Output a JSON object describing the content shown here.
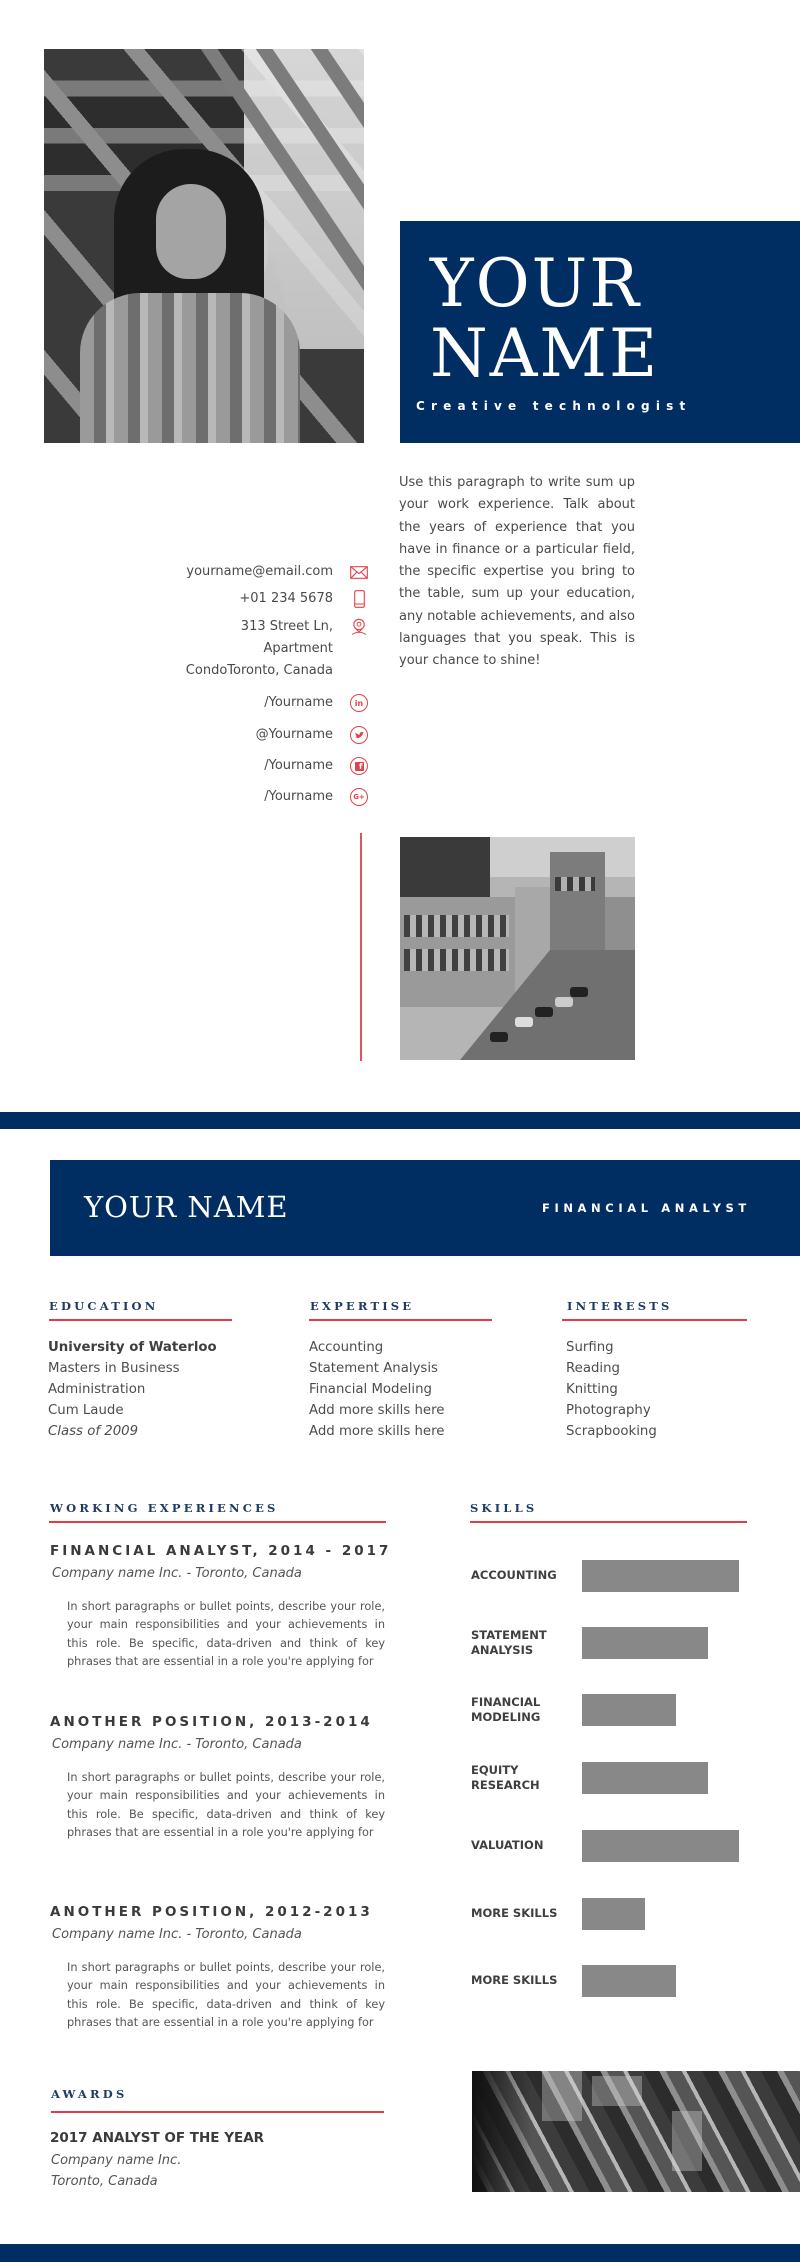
{
  "colors": {
    "navy": "#002e62",
    "accent_red": "#e03c44",
    "bar_gray": "#888888"
  },
  "page1": {
    "hero": {
      "name_line1": "YOUR",
      "name_line2": "NAME",
      "subtitle": "Creative technologist"
    },
    "summary": "Use this paragraph to write sum up your work experience. Talk about the years of experience that you have in finance or a particular field, the specific expertise you bring to the table, sum up your education, any notable achievements, and also languages that you speak. This is your chance to shine!",
    "contact": {
      "email": {
        "value": "yourname@email.com",
        "icon": "envelope-icon"
      },
      "phone": {
        "value": "+01 234 5678",
        "icon": "phone-icon"
      },
      "address": {
        "line1": "313 Street Ln,",
        "line2": "Apartment",
        "line3": "CondoToronto, Canada",
        "icon": "location-pin-icon"
      }
    },
    "social": [
      {
        "handle": "/Yourname",
        "icon": "linkedin-icon",
        "glyph": "in"
      },
      {
        "handle": "@Yourname",
        "icon": "twitter-icon",
        "glyph": "🐦"
      },
      {
        "handle": "/Yourname",
        "icon": "facebook-icon",
        "glyph": "f"
      },
      {
        "handle": "/Yourname",
        "icon": "google-plus-icon",
        "glyph": "G+"
      }
    ]
  },
  "page2": {
    "header": {
      "name": "YOUR NAME",
      "title": "FINANCIAL ANALYST"
    },
    "education": {
      "heading": "EDUCATION",
      "school": "University of Waterloo",
      "degree_line1": "Masters in Business",
      "degree_line2": "Administration",
      "honors": "Cum Laude",
      "class": "Class of 2009"
    },
    "expertise": {
      "heading": "EXPERTISE",
      "items": [
        "Accounting",
        "Statement Analysis",
        "Financial Modeling",
        "Add more skills here",
        "Add more skills here"
      ]
    },
    "interests": {
      "heading": "INTERESTS",
      "items": [
        "Surfing",
        "Reading",
        "Knitting",
        "Photography",
        "Scrapbooking"
      ]
    },
    "experience": {
      "heading": "WORKING EXPERIENCES",
      "jobs": [
        {
          "title": "FINANCIAL ANALYST, 2014 - 2017",
          "company": "Company name Inc. - Toronto, Canada",
          "description": "In short paragraphs or bullet points, describe your role, your main responsibilities and your achievements in this role. Be specific, data-driven and think of key phrases that are essential in a role you're applying for"
        },
        {
          "title": "ANOTHER POSITION, 2013-2014",
          "company": "Company name Inc. - Toronto, Canada",
          "description": "In short paragraphs or bullet points, describe your role, your main responsibilities and your achievements in this role. Be specific, data-driven and think of key phrases that are essential in a role you're applying for"
        },
        {
          "title": "ANOTHER POSITION, 2012-2013",
          "company": "Company name Inc. - Toronto, Canada",
          "description": "In short paragraphs or bullet points, describe your role, your main responsibilities and your achievements in this role. Be specific, data-driven and think of key phrases that are essential in a role you're applying for"
        }
      ]
    },
    "skills": {
      "heading": "SKILLS",
      "items": [
        {
          "label_line1": "ACCOUNTING",
          "label_line2": "",
          "level": 1.0
        },
        {
          "label_line1": "STATEMENT",
          "label_line2": "ANALYSIS",
          "level": 0.8
        },
        {
          "label_line1": "FINANCIAL",
          "label_line2": "MODELING",
          "level": 0.6
        },
        {
          "label_line1": "EQUITY",
          "label_line2": "RESEARCH",
          "level": 0.8
        },
        {
          "label_line1": "VALUATION",
          "label_line2": "",
          "level": 1.0
        },
        {
          "label_line1": "MORE SKILLS",
          "label_line2": "",
          "level": 0.4
        },
        {
          "label_line1": "MORE SKILLS",
          "label_line2": "",
          "level": 0.6
        }
      ]
    },
    "awards": {
      "heading": "AWARDS",
      "title": "2017 ANALYST OF THE YEAR",
      "company": "Company name Inc.",
      "location": "Toronto, Canada"
    }
  }
}
